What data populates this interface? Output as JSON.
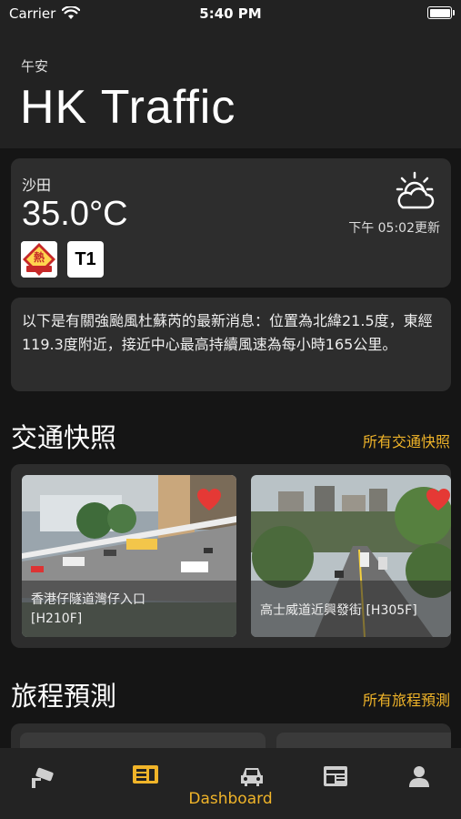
{
  "status_bar": {
    "carrier": "Carrier",
    "time": "5:40 PM"
  },
  "header": {
    "greeting": "午安",
    "title": "HK Traffic"
  },
  "weather": {
    "district": "沙田",
    "temperature": "35.0°C",
    "updated": "下午 05:02更新",
    "warnings": [
      {
        "icon": "very-hot-warning-icon",
        "text": "熱"
      },
      {
        "icon": "typhoon-signal-1-icon",
        "text": "T1"
      }
    ],
    "icon": "cloudy-sun-icon"
  },
  "news": {
    "text": "以下是有關強颱風杜蘇芮的最新消息：位置為北緯21.5度，東經119.3度附近，接近中心最高持續風速為每小時165公里。"
  },
  "traffic_snapshots": {
    "title": "交通快照",
    "link": "所有交通快照",
    "items": [
      {
        "name_line1": "香港仔隧道灣仔入口",
        "name_line2": "[H210F]",
        "favorite": true
      },
      {
        "name_line1": "高士威道近興發街 [H305F]",
        "name_line2": "",
        "favorite": true
      }
    ]
  },
  "journey": {
    "title": "旅程預測",
    "link": "所有旅程預測"
  },
  "tabs": [
    {
      "icon": "traffic-camera-icon",
      "label": ""
    },
    {
      "icon": "dashboard-icon",
      "label": "Dashboard",
      "active": true
    },
    {
      "icon": "car-icon",
      "label": ""
    },
    {
      "icon": "news-icon",
      "label": ""
    },
    {
      "icon": "profile-icon",
      "label": ""
    }
  ],
  "colors": {
    "accent": "#f0b429",
    "background": "#151515",
    "card": "#2d2d2d",
    "favorite": "#e53935"
  }
}
